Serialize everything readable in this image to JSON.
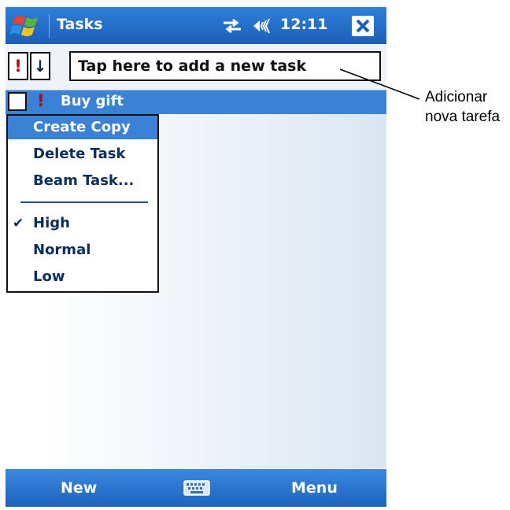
{
  "window": {
    "app_title": "Tasks",
    "clock": "12:11",
    "icons": {
      "start": "windows-flag-icon",
      "connectivity": "sync-arrows-icon",
      "volume": "speaker-icon",
      "close": "close-icon"
    }
  },
  "entry_bar": {
    "priority_button": "!",
    "sort_button": "↓",
    "input_text": "Tap here to add a new task"
  },
  "tasks": [
    {
      "title": "Buy gift",
      "priority_marker": "!",
      "checked": false,
      "selected": true
    }
  ],
  "context_menu": {
    "items": [
      {
        "label": "Create Copy",
        "active": true
      },
      {
        "label": "Delete Task"
      },
      {
        "label": "Beam Task..."
      }
    ],
    "priority_items": [
      {
        "label": "High",
        "checked": true,
        "check_glyph": "✔"
      },
      {
        "label": "Normal",
        "checked": false
      },
      {
        "label": "Low",
        "checked": false
      }
    ]
  },
  "menu_bar": {
    "left_soft_key": "New",
    "right_soft_key": "Menu",
    "keyboard_icon": "keyboard-icon"
  },
  "callout": {
    "line1": "Adicionar",
    "line2": "nova tarefa"
  },
  "colors": {
    "title_bar": "#1c5fb8",
    "selection": "#3b82d6",
    "priority_red": "#c0000f"
  }
}
